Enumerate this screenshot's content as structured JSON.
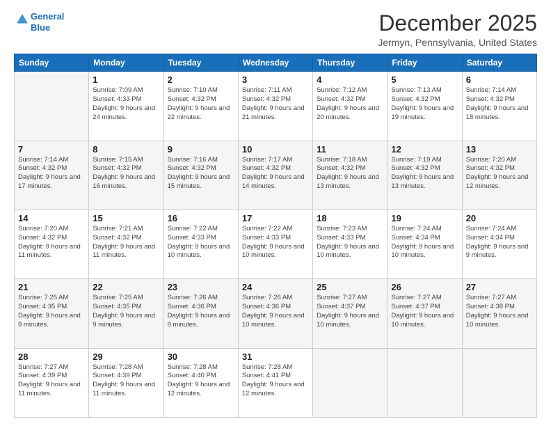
{
  "logo": {
    "line1": "General",
    "line2": "Blue"
  },
  "title": "December 2025",
  "subtitle": "Jermyn, Pennsylvania, United States",
  "days_header": [
    "Sunday",
    "Monday",
    "Tuesday",
    "Wednesday",
    "Thursday",
    "Friday",
    "Saturday"
  ],
  "weeks": [
    [
      {
        "num": "",
        "sunrise": "",
        "sunset": "",
        "daylight": ""
      },
      {
        "num": "1",
        "sunrise": "Sunrise: 7:09 AM",
        "sunset": "Sunset: 4:33 PM",
        "daylight": "Daylight: 9 hours and 24 minutes."
      },
      {
        "num": "2",
        "sunrise": "Sunrise: 7:10 AM",
        "sunset": "Sunset: 4:32 PM",
        "daylight": "Daylight: 9 hours and 22 minutes."
      },
      {
        "num": "3",
        "sunrise": "Sunrise: 7:11 AM",
        "sunset": "Sunset: 4:32 PM",
        "daylight": "Daylight: 9 hours and 21 minutes."
      },
      {
        "num": "4",
        "sunrise": "Sunrise: 7:12 AM",
        "sunset": "Sunset: 4:32 PM",
        "daylight": "Daylight: 9 hours and 20 minutes."
      },
      {
        "num": "5",
        "sunrise": "Sunrise: 7:13 AM",
        "sunset": "Sunset: 4:32 PM",
        "daylight": "Daylight: 9 hours and 19 minutes."
      },
      {
        "num": "6",
        "sunrise": "Sunrise: 7:14 AM",
        "sunset": "Sunset: 4:32 PM",
        "daylight": "Daylight: 9 hours and 18 minutes."
      }
    ],
    [
      {
        "num": "7",
        "sunrise": "Sunrise: 7:14 AM",
        "sunset": "Sunset: 4:32 PM",
        "daylight": "Daylight: 9 hours and 17 minutes."
      },
      {
        "num": "8",
        "sunrise": "Sunrise: 7:15 AM",
        "sunset": "Sunset: 4:32 PM",
        "daylight": "Daylight: 9 hours and 16 minutes."
      },
      {
        "num": "9",
        "sunrise": "Sunrise: 7:16 AM",
        "sunset": "Sunset: 4:32 PM",
        "daylight": "Daylight: 9 hours and 15 minutes."
      },
      {
        "num": "10",
        "sunrise": "Sunrise: 7:17 AM",
        "sunset": "Sunset: 4:32 PM",
        "daylight": "Daylight: 9 hours and 14 minutes."
      },
      {
        "num": "11",
        "sunrise": "Sunrise: 7:18 AM",
        "sunset": "Sunset: 4:32 PM",
        "daylight": "Daylight: 9 hours and 13 minutes."
      },
      {
        "num": "12",
        "sunrise": "Sunrise: 7:19 AM",
        "sunset": "Sunset: 4:32 PM",
        "daylight": "Daylight: 9 hours and 13 minutes."
      },
      {
        "num": "13",
        "sunrise": "Sunrise: 7:20 AM",
        "sunset": "Sunset: 4:32 PM",
        "daylight": "Daylight: 9 hours and 12 minutes."
      }
    ],
    [
      {
        "num": "14",
        "sunrise": "Sunrise: 7:20 AM",
        "sunset": "Sunset: 4:32 PM",
        "daylight": "Daylight: 9 hours and 11 minutes."
      },
      {
        "num": "15",
        "sunrise": "Sunrise: 7:21 AM",
        "sunset": "Sunset: 4:32 PM",
        "daylight": "Daylight: 9 hours and 11 minutes."
      },
      {
        "num": "16",
        "sunrise": "Sunrise: 7:22 AM",
        "sunset": "Sunset: 4:33 PM",
        "daylight": "Daylight: 9 hours and 10 minutes."
      },
      {
        "num": "17",
        "sunrise": "Sunrise: 7:22 AM",
        "sunset": "Sunset: 4:33 PM",
        "daylight": "Daylight: 9 hours and 10 minutes."
      },
      {
        "num": "18",
        "sunrise": "Sunrise: 7:23 AM",
        "sunset": "Sunset: 4:33 PM",
        "daylight": "Daylight: 9 hours and 10 minutes."
      },
      {
        "num": "19",
        "sunrise": "Sunrise: 7:24 AM",
        "sunset": "Sunset: 4:34 PM",
        "daylight": "Daylight: 9 hours and 10 minutes."
      },
      {
        "num": "20",
        "sunrise": "Sunrise: 7:24 AM",
        "sunset": "Sunset: 4:34 PM",
        "daylight": "Daylight: 9 hours and 9 minutes."
      }
    ],
    [
      {
        "num": "21",
        "sunrise": "Sunrise: 7:25 AM",
        "sunset": "Sunset: 4:35 PM",
        "daylight": "Daylight: 9 hours and 9 minutes."
      },
      {
        "num": "22",
        "sunrise": "Sunrise: 7:25 AM",
        "sunset": "Sunset: 4:35 PM",
        "daylight": "Daylight: 9 hours and 9 minutes."
      },
      {
        "num": "23",
        "sunrise": "Sunrise: 7:26 AM",
        "sunset": "Sunset: 4:36 PM",
        "daylight": "Daylight: 9 hours and 9 minutes."
      },
      {
        "num": "24",
        "sunrise": "Sunrise: 7:26 AM",
        "sunset": "Sunset: 4:36 PM",
        "daylight": "Daylight: 9 hours and 10 minutes."
      },
      {
        "num": "25",
        "sunrise": "Sunrise: 7:27 AM",
        "sunset": "Sunset: 4:37 PM",
        "daylight": "Daylight: 9 hours and 10 minutes."
      },
      {
        "num": "26",
        "sunrise": "Sunrise: 7:27 AM",
        "sunset": "Sunset: 4:37 PM",
        "daylight": "Daylight: 9 hours and 10 minutes."
      },
      {
        "num": "27",
        "sunrise": "Sunrise: 7:27 AM",
        "sunset": "Sunset: 4:38 PM",
        "daylight": "Daylight: 9 hours and 10 minutes."
      }
    ],
    [
      {
        "num": "28",
        "sunrise": "Sunrise: 7:27 AM",
        "sunset": "Sunset: 4:39 PM",
        "daylight": "Daylight: 9 hours and 11 minutes."
      },
      {
        "num": "29",
        "sunrise": "Sunrise: 7:28 AM",
        "sunset": "Sunset: 4:39 PM",
        "daylight": "Daylight: 9 hours and 11 minutes."
      },
      {
        "num": "30",
        "sunrise": "Sunrise: 7:28 AM",
        "sunset": "Sunset: 4:40 PM",
        "daylight": "Daylight: 9 hours and 12 minutes."
      },
      {
        "num": "31",
        "sunrise": "Sunrise: 7:28 AM",
        "sunset": "Sunset: 4:41 PM",
        "daylight": "Daylight: 9 hours and 12 minutes."
      },
      {
        "num": "",
        "sunrise": "",
        "sunset": "",
        "daylight": ""
      },
      {
        "num": "",
        "sunrise": "",
        "sunset": "",
        "daylight": ""
      },
      {
        "num": "",
        "sunrise": "",
        "sunset": "",
        "daylight": ""
      }
    ]
  ]
}
